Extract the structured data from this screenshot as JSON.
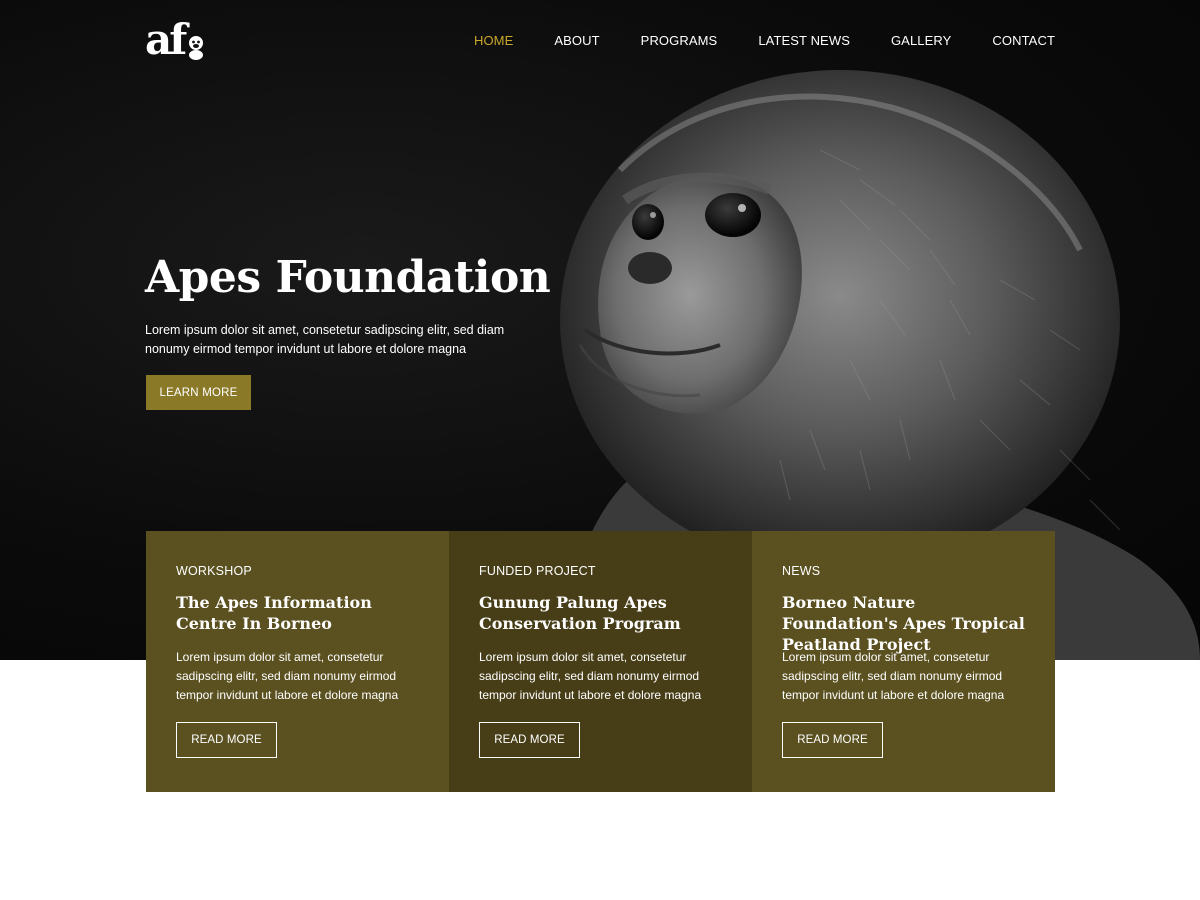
{
  "brand": {
    "logo_text": "af"
  },
  "nav": {
    "items": [
      {
        "label": "HOME"
      },
      {
        "label": "ABOUT"
      },
      {
        "label": "PROGRAMS"
      },
      {
        "label": "LATEST NEWS"
      },
      {
        "label": "GALLERY"
      },
      {
        "label": "CONTACT"
      }
    ],
    "active_index": 0
  },
  "hero": {
    "title": "Apes Foundation",
    "text": "Lorem ipsum dolor sit amet, consetetur sadipscing elitr, sed diam nonumy eirmod tempor invidunt ut labore et dolore magna",
    "button_label": "LEARN MORE",
    "image": "monkey-portrait-photo"
  },
  "cards": [
    {
      "tag": "WORKSHOP",
      "title": "The Apes Information Centre In Borneo",
      "text": "Lorem ipsum dolor sit amet, consetetur sadipscing elitr, sed diam nonumy eirmod tempor invidunt ut labore et dolore magna",
      "button_label": "READ MORE"
    },
    {
      "tag": "FUNDED PROJECT",
      "title": "Gunung Palung Apes Conservation Program",
      "text": "Lorem ipsum dolor sit amet, consetetur sadipscing elitr, sed diam nonumy eirmod tempor invidunt ut labore et dolore magna",
      "button_label": "READ MORE"
    },
    {
      "tag": "NEWS",
      "title": "Borneo Nature Foundation's Apes Tropical Peatland Project",
      "text": "Lorem ipsum dolor sit amet, consetetur sadipscing elitr, sed diam nonumy eirmod tempor invidunt ut labore et dolore magna",
      "button_label": "READ MORE"
    }
  ],
  "colors": {
    "accent": "#c9a72a",
    "button": "#8a7a28",
    "card_light": "#5a5020",
    "card_dark": "#473e18",
    "hero_bg": "#0b0b0b"
  }
}
